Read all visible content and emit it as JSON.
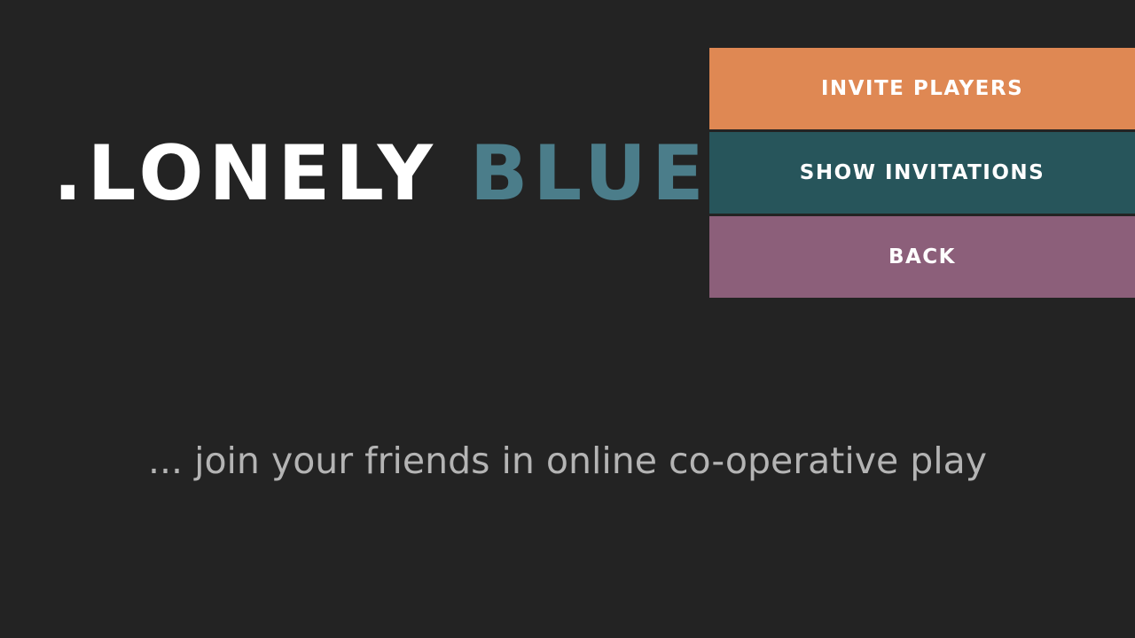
{
  "logo": {
    "part1": ".LONELY",
    "part2": "BLUE",
    "primary_color": "#ffffff",
    "accent_color": "#4b7d8a"
  },
  "menu": {
    "items": [
      {
        "label": "INVITE PLAYERS",
        "color": "#df8853"
      },
      {
        "label": "SHOW INVITATIONS",
        "color": "#27555b"
      },
      {
        "label": "BACK",
        "color": "#8c5f7a"
      }
    ]
  },
  "tagline": "... join your friends in online co-operative play",
  "colors": {
    "background": "#232323",
    "tagline_text": "#b4b4b4"
  }
}
